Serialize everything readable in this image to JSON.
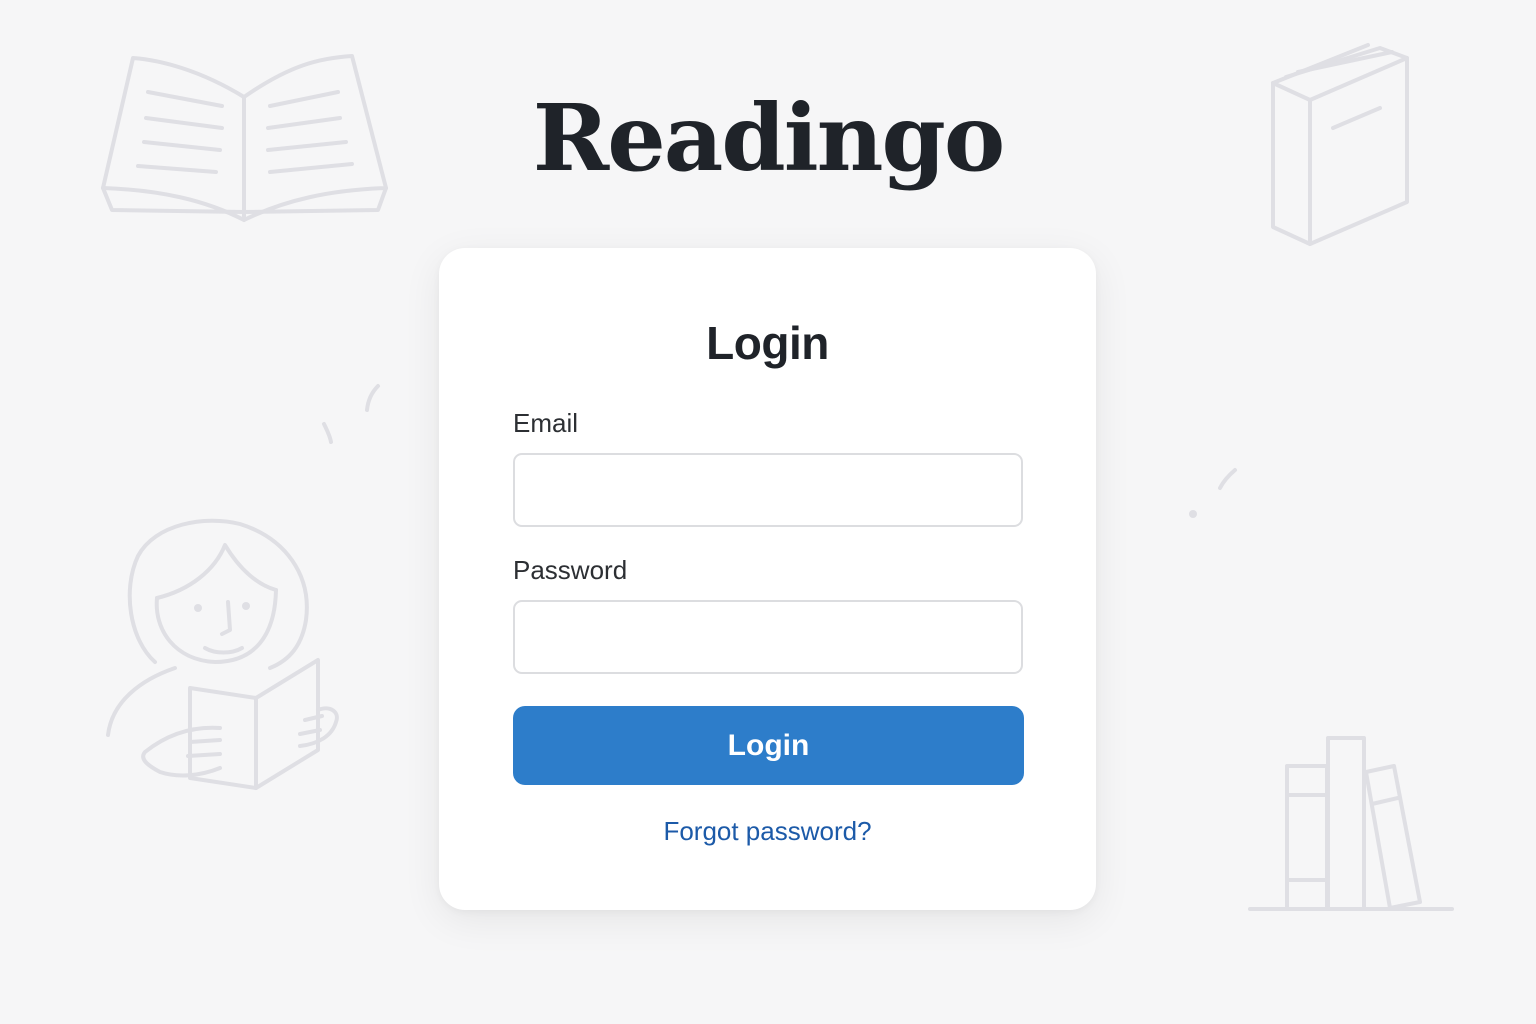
{
  "app": {
    "title": "Readingo"
  },
  "login_card": {
    "heading": "Login",
    "email": {
      "label": "Email",
      "value": "",
      "placeholder": ""
    },
    "password": {
      "label": "Password",
      "value": "",
      "placeholder": ""
    },
    "submit_label": "Login",
    "forgot_password_label": "Forgot password?"
  },
  "colors": {
    "background": "#f6f6f7",
    "primary_button": "#2d7dca",
    "link": "#1c5aa8",
    "illustration_line": "#dfdfe4"
  },
  "decorations": {
    "icons": [
      "open-book-icon",
      "closed-book-icon",
      "reader-person-icon",
      "bookshelf-icon"
    ]
  }
}
